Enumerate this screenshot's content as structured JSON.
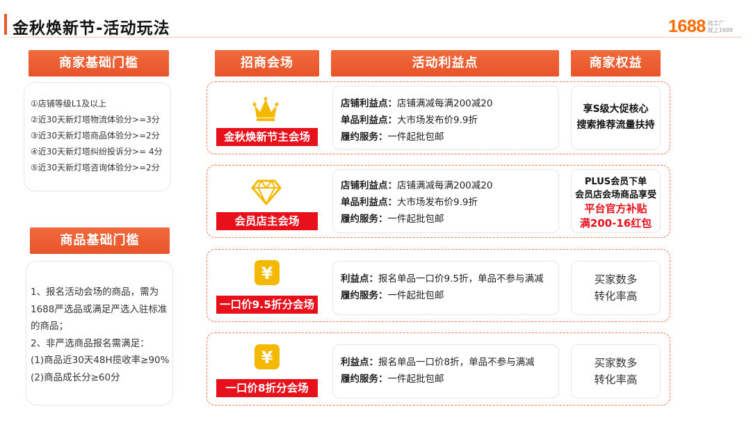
{
  "title": "金秋焕新节-活动玩法",
  "logo": {
    "number": "1688",
    "sub1": "找工厂",
    "sub2": "就上1688"
  },
  "headers": {
    "merchant_threshold": "商家基础门槛",
    "goods_threshold": "商品基础门槛",
    "venue": "招商会场",
    "benefit": "活动利益点",
    "rights": "商家权益"
  },
  "merchant_requirements": [
    "①店铺等级L1及以上",
    "②近30天新灯塔物流体验分>=3分",
    "③近30天新灯塔商品体验分>=2分",
    "④近30天新灯塔纠纷投诉分>= 4分",
    "⑤近30天新灯塔咨询体验分>=2分"
  ],
  "goods_requirements": [
    "1、报名活动会场的商品，需为",
    "1688严选品或满足严选入驻标准",
    "的商品；",
    "2、非严选商品报名需满足：",
    "(1)商品近30天48H揽收率≥90%",
    "(2)商品成长分≥60分"
  ],
  "rows": [
    {
      "icon": "crown-icon",
      "venue": "金秋焕新节主会场",
      "benefits": [
        {
          "label": "店铺利益点：",
          "text": "店铺满减每满200减20"
        },
        {
          "label": "单品利益点：",
          "text": "大市场发布价9.9折"
        },
        {
          "label": "履约服务：",
          "text": "一件起批包邮"
        }
      ],
      "rights": [
        "享S级大促核心",
        "搜索推荐流量扶持"
      ]
    },
    {
      "icon": "diamond-icon",
      "venue": "会员店主会场",
      "benefits": [
        {
          "label": "店铺利益点：",
          "text": "店铺满减每满200减20"
        },
        {
          "label": "单品利益点：",
          "text": "大市场发布价9.9折"
        },
        {
          "label": "履约服务：",
          "text": "一件起批包邮"
        }
      ],
      "rights": [
        "PLUS会员下单",
        "会员店会场商品享受",
        "平台官方补贴",
        "满200-16红包"
      ]
    },
    {
      "icon": "yen-icon",
      "venue": "一口价9.5折分会场",
      "benefits": [
        {
          "label": "利益点：",
          "text": "报名单品一口价9.5折，单品不参与满减"
        },
        {
          "label": "履约服务：",
          "text": "一件起批包邮"
        }
      ],
      "rights": [
        "买家数多",
        "转化率高"
      ]
    },
    {
      "icon": "yen-icon",
      "venue": "一口价8折分会场",
      "benefits": [
        {
          "label": "利益点：",
          "text": "报名单品一口价8折，单品不参与满减"
        },
        {
          "label": "履约服务：",
          "text": "一件起批包邮"
        }
      ],
      "rights": [
        "买家数多",
        "转化率高"
      ]
    }
  ],
  "colors": {
    "accent": "#e8572a",
    "red": "#e8101a",
    "gold": "#f5b800"
  }
}
